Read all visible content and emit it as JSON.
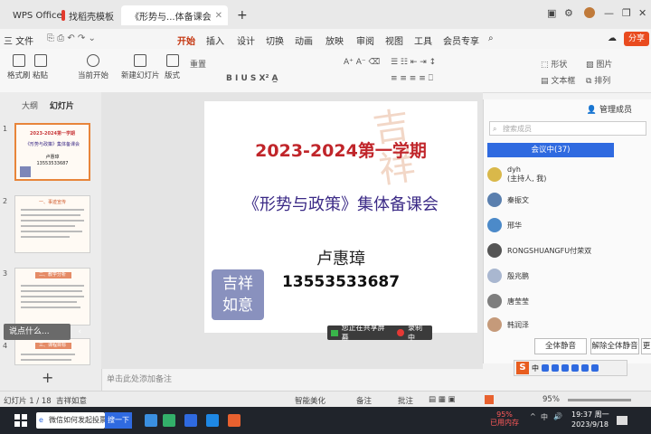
{
  "window": {
    "tabs": [
      {
        "label": "WPS Office",
        "color": "#e23b2e"
      },
      {
        "label": "找稻壳模板",
        "color": "#e23b2e"
      },
      {
        "label": "《形势与...体备课会",
        "color": "#e8612f"
      }
    ],
    "new_tab": "+",
    "controls": {
      "minimize": "—",
      "restore": "❐",
      "close": "✕"
    }
  },
  "menubar": {
    "file": "三 文件",
    "items": [
      "开始",
      "插入",
      "设计",
      "切换",
      "动画",
      "放映",
      "审阅",
      "视图",
      "工具",
      "会员专享"
    ],
    "active": "开始",
    "share": "分享"
  },
  "ribbon": {
    "format_painter": "格式刷",
    "paste": "粘贴",
    "play_from_current": "当前开始",
    "new_slide": "新建幻灯片",
    "layout": "版式",
    "reset": "重置",
    "shape": "形状",
    "picture": "图片",
    "textbox": "文本框",
    "arrange": "排列"
  },
  "left_panel": {
    "tabs": [
      "大纲",
      "幻灯片"
    ],
    "slide_numbers": [
      "1",
      "2",
      "3",
      "4"
    ],
    "thumb1_title": "2023-2024第一学期",
    "thumb1_sub": "《形势与政策》集体备课会",
    "thumb1_name": "卢惠璋",
    "thumb1_phone": "13553533687",
    "thumb2_header": "一、事迹宣传",
    "thumb3_header": "二、教学分析",
    "thumb4_header": "三、课程目标",
    "popup": "说点什么...",
    "add_slide": "+"
  },
  "slide": {
    "title": "2023-2024第一学期",
    "subtitle": "《形势与政策》集体备课会",
    "name": "卢惠璋",
    "phone": "13553533687",
    "stamp_text": "吉祥如意"
  },
  "share_bar": {
    "sharing": "您正在共享屏幕",
    "recording": "录制中"
  },
  "notes_placeholder": "单击此处添加备注",
  "meeting": {
    "title": "管理成员",
    "search_placeholder": "搜索成员",
    "tab_in_meeting": "会议中(37)",
    "members": [
      {
        "name": "dyh",
        "role": "(主持人, 我)"
      },
      {
        "name": "秦振文",
        "role": ""
      },
      {
        "name": "邢华",
        "role": ""
      },
      {
        "name": "RONGSHUANGFU付荣双",
        "role": ""
      },
      {
        "name": "殷兆鹏",
        "role": ""
      },
      {
        "name": "唐莹莹",
        "role": ""
      },
      {
        "name": "韩润泽",
        "role": ""
      }
    ],
    "mute_all": "全体静音",
    "unmute_all": "解除全体静音",
    "more": "更"
  },
  "statusbar": {
    "slide_pos": "幻灯片 1 / 18",
    "theme": "吉祥如意",
    "smart_beautify": "智能美化",
    "notes": "备注",
    "comments": "批注",
    "zoom": "95%"
  },
  "ime": {
    "logo": "S",
    "lang": "中"
  },
  "taskbar": {
    "search_text": "微信如何发起投票",
    "search_button": "搜一下",
    "memory": "95%",
    "memory_label": "已用内存",
    "tray_lang": "中",
    "time": "19:37 周一",
    "date": "2023/9/18"
  }
}
